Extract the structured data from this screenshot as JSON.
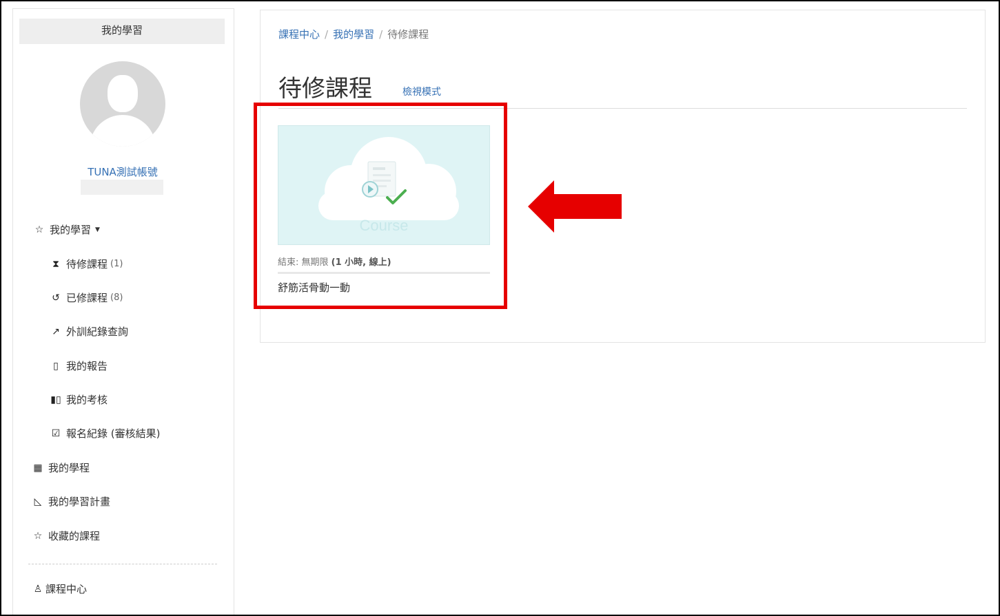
{
  "sidebar": {
    "header": "我的學習",
    "username": "TUNA測試帳號",
    "my_learning": {
      "icon": "star-outline-icon",
      "label": "我的學習"
    },
    "sub_items": [
      {
        "icon": "hourglass-icon",
        "label": "待修課程",
        "count": "(1)"
      },
      {
        "icon": "history-icon",
        "label": "已修課程",
        "count": "(8)"
      },
      {
        "icon": "external-link-icon",
        "label": "外訓紀錄查詢",
        "count": ""
      },
      {
        "icon": "clipboard-icon",
        "label": "我的報告",
        "count": ""
      },
      {
        "icon": "exam-icon",
        "label": "我的考核",
        "count": ""
      },
      {
        "icon": "checkbox-icon",
        "label": "報名紀錄 (審核結果)",
        "count": ""
      }
    ],
    "items": [
      {
        "icon": "grid-icon",
        "label": "我的學程"
      },
      {
        "icon": "ruler-triangle-icon",
        "label": "我的學習計畫"
      },
      {
        "icon": "star-outline-icon",
        "label": "收藏的課程"
      }
    ],
    "course_center": {
      "icon": "people-icon",
      "label": "課程中心"
    }
  },
  "breadcrumb": {
    "items": [
      "課程中心",
      "我的學習",
      "待修課程"
    ],
    "separator": "/"
  },
  "page": {
    "title": "待修課程",
    "view_mode": "檢視模式"
  },
  "course_card": {
    "thumbnail_text": "Course",
    "end_label": "結束: 無期限",
    "detail": "(1 小時, 線上)",
    "title": "舒筋活骨動一動"
  },
  "colors": {
    "link": "#3570b4",
    "highlight": "#e60000",
    "thumbnail_bg": "#dff4f5",
    "check": "#4caf50"
  }
}
